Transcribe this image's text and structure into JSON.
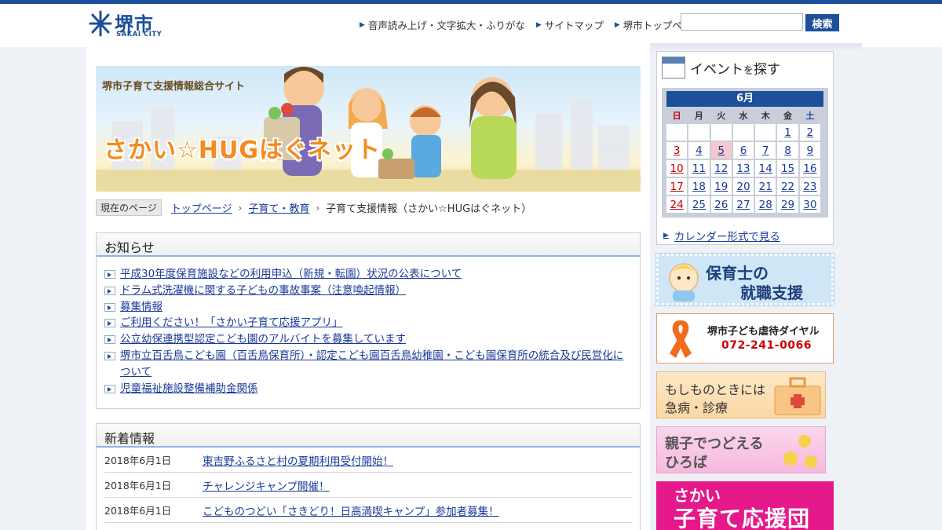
{
  "header": {
    "logo_text": "堺市",
    "logo_sub": "SAKAI CITY",
    "util_links": [
      "音声読み上げ・文字拡大・ふりがな",
      "サイトマップ",
      "堺市トップページ"
    ],
    "search_placeholder": "",
    "search_button": "検索",
    "accent_color": "#1d4f9a"
  },
  "banner": {
    "subtitle": "堺市子育て支援情報総合サイト",
    "title": "さかい☆HUGはぐネット"
  },
  "breadcrumb": {
    "label": "現在のページ",
    "items": [
      "トップページ",
      "子育て・教育"
    ],
    "current": "子育て支援情報（さかい☆HUGはぐネット）"
  },
  "news": {
    "heading": "お知らせ",
    "items": [
      "平成30年度保育施設などの利用申込（新規・転園）状況の公表について",
      "ドラム式洗濯機に関する子どもの事故事案（注意喚起情報）",
      "募集情報",
      "ご利用ください！「さかい子育て応援アプリ」",
      "公立幼保連携型認定こども園のアルバイトを募集しています",
      "堺市立百舌鳥こども園（百舌鳥保育所）・認定こども園百舌鳥幼稚園・こども園保育所の統合及び民営化について",
      "児童福祉施設整備補助金関係"
    ]
  },
  "new_info": {
    "heading": "新着情報",
    "rows": [
      {
        "date": "2018年6月1日",
        "title": "東吉野ふるさと村の夏期利用受付開始！"
      },
      {
        "date": "2018年6月1日",
        "title": "チャレンジキャンプ開催！"
      },
      {
        "date": "2018年6月1日",
        "title": "こどものつどい「さきどり！日高満喫キャンプ」参加者募集！"
      }
    ]
  },
  "calendar": {
    "title_main": "イベント",
    "title_small": "を",
    "title_end": "探す",
    "month": "6月",
    "weekdays": [
      "日",
      "月",
      "火",
      "水",
      "木",
      "金",
      "土"
    ],
    "weeks": [
      [
        "",
        "",
        "",
        "",
        "",
        "1",
        "2"
      ],
      [
        "3",
        "4",
        "5",
        "6",
        "7",
        "8",
        "9"
      ],
      [
        "10",
        "11",
        "12",
        "13",
        "14",
        "15",
        "16"
      ],
      [
        "17",
        "18",
        "19",
        "20",
        "21",
        "22",
        "23"
      ],
      [
        "24",
        "25",
        "26",
        "27",
        "28",
        "29",
        "30"
      ]
    ],
    "today": "5",
    "link": "カレンダー形式で見る"
  },
  "side_banners": {
    "hoikushi": {
      "line1": "保育士の",
      "line2": "就職支援"
    },
    "dial": {
      "line1": "堺市子ども虐待ダイヤル",
      "line2": "072-241-0066"
    },
    "kyubyo": {
      "line1": "もしものときには",
      "line2": "急病・診療"
    },
    "hiroba": {
      "line1": "親子でつどえる",
      "line2": "ひろば"
    },
    "ouen": {
      "line1": "さかい",
      "line2": "子育て応援団"
    }
  }
}
